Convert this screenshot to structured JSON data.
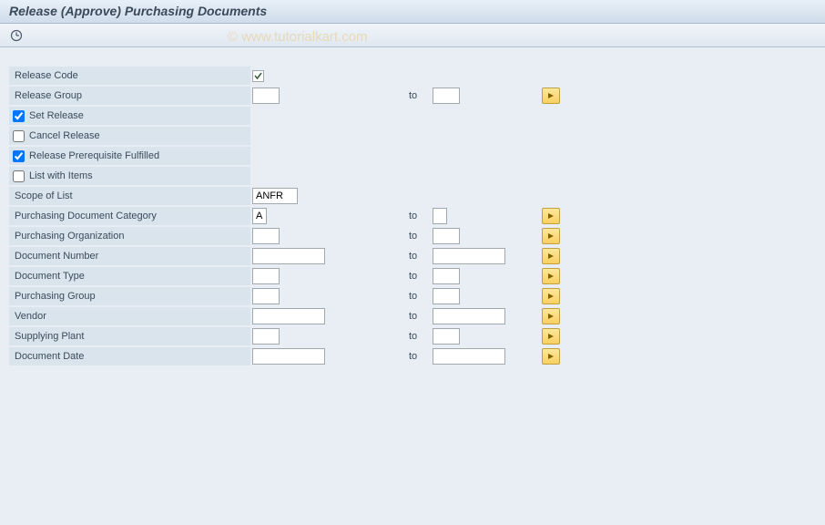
{
  "title": "Release (Approve) Purchasing Documents",
  "watermark": "© www.tutorialkart.com",
  "fields": {
    "releaseCode": {
      "label": "Release Code",
      "value": ""
    },
    "releaseGroup": {
      "label": "Release Group",
      "from": "",
      "to": ""
    },
    "setRelease": {
      "label": "Set Release",
      "checked": true
    },
    "cancelRelease": {
      "label": "Cancel Release",
      "checked": false
    },
    "releasePrereq": {
      "label": "Release Prerequisite Fulfilled",
      "checked": true
    },
    "listWithItems": {
      "label": "List with Items",
      "checked": false
    },
    "scopeOfList": {
      "label": "Scope of List",
      "value": "ANFR"
    },
    "docCategory": {
      "label": "Purchasing Document Category",
      "from": "A",
      "to": ""
    },
    "purchOrg": {
      "label": "Purchasing Organization",
      "from": "",
      "to": ""
    },
    "docNumber": {
      "label": "Document Number",
      "from": "",
      "to": ""
    },
    "docType": {
      "label": "Document Type",
      "from": "",
      "to": ""
    },
    "purchGroup": {
      "label": "Purchasing Group",
      "from": "",
      "to": ""
    },
    "vendor": {
      "label": "Vendor",
      "from": "",
      "to": ""
    },
    "supplyingPlant": {
      "label": "Supplying Plant",
      "from": "",
      "to": ""
    },
    "docDate": {
      "label": "Document Date",
      "from": "",
      "to": ""
    }
  },
  "toLabel": "to"
}
